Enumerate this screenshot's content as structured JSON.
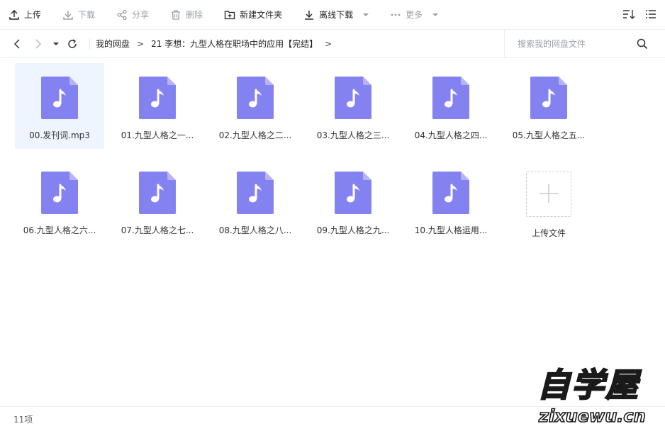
{
  "toolbar": {
    "upload": "上传",
    "download": "下载",
    "share": "分享",
    "delete": "删除",
    "new_folder": "新建文件夹",
    "offline_download": "离线下载",
    "more": "更多"
  },
  "nav": {
    "breadcrumbs": [
      "我的网盘",
      "21 李想：九型人格在职场中的应用【完结】"
    ],
    "separator": ">",
    "search_placeholder": "搜索我的网盘文件"
  },
  "files": [
    {
      "name": "00.发刊词.mp3",
      "selected": true
    },
    {
      "name": "01.九型人格之一...",
      "selected": false
    },
    {
      "name": "02.九型人格之二...",
      "selected": false
    },
    {
      "name": "03.九型人格之三...",
      "selected": false
    },
    {
      "name": "04.九型人格之四...",
      "selected": false
    },
    {
      "name": "05.九型人格之五...",
      "selected": false
    },
    {
      "name": "06.九型人格之六...",
      "selected": false
    },
    {
      "name": "07.九型人格之七...",
      "selected": false
    },
    {
      "name": "08.九型人格之八...",
      "selected": false
    },
    {
      "name": "09.九型人格之九...",
      "selected": false
    },
    {
      "name": "10.九型人格运用...",
      "selected": false
    }
  ],
  "upload_tile": {
    "label": "上传文件"
  },
  "status": {
    "count": "11项"
  },
  "watermark": {
    "line1": "自学屋",
    "line2": "zixuewu.cn"
  },
  "colors": {
    "file_icon": "#8482f0",
    "file_fold": "#b6b4f7",
    "selected_bg": "#eef5ff",
    "disabled": "#9aa0a8"
  }
}
